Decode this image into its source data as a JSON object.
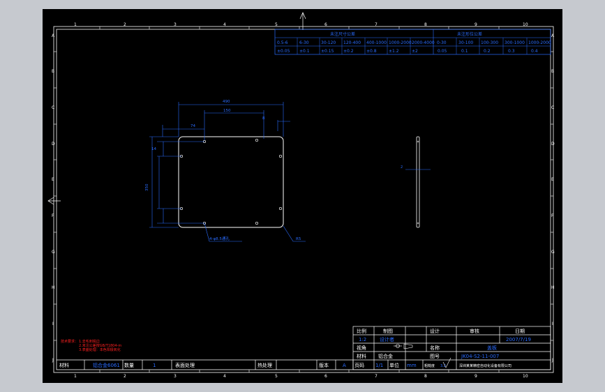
{
  "drawing": {
    "border_columns": [
      "1",
      "2",
      "3",
      "4",
      "5",
      "6",
      "7",
      "8",
      "9",
      "10"
    ],
    "border_rows": [
      "A",
      "B",
      "C",
      "D",
      "E",
      "F",
      "G",
      "H",
      "I",
      "J"
    ],
    "tolerance_table": {
      "title_left": "未注尺寸公差",
      "title_right": "未注形位公差",
      "header_left": [
        "0.5-6",
        "6-30",
        "30-120",
        "120-400",
        "400-1000",
        "1000-2000",
        "2000-4000"
      ],
      "header_right": [
        "0-30",
        "30-100",
        "100-300",
        "300-1000",
        "1000-2000"
      ],
      "values_left": [
        "±0.05",
        "±0.1",
        "±0.15",
        "±0.2",
        "±0.8",
        "±1.2",
        "±2"
      ],
      "values_right": [
        "0.05",
        "0.1",
        "0.2",
        "0.3",
        "0.4"
      ]
    },
    "dims": {
      "overall_width": "490",
      "inner_width": "150",
      "left_offset": "74",
      "right_offset": "8",
      "height_overall": "350",
      "side_small": "14",
      "hole_note": "4-φ8.5通孔",
      "corner_note": "R5",
      "section_note": "2"
    },
    "notes": {
      "title": "技术要求：",
      "lines": [
        "1.去毛刺锐边",
        "2.未注公差按GB/T1804-m",
        "3.表面处理：本色阳极氧化"
      ]
    },
    "title_block": {
      "scale_label": "比例",
      "scale_value": "1:2",
      "draw_label": "制图",
      "drawer": "设计者",
      "design_label": "设计",
      "check_label": "审核",
      "date_label": "日期",
      "date_value": "2007/7/19",
      "mark_label": "视角",
      "name_label": "名称",
      "name_value": "盖板",
      "material_label": "材料",
      "material_value": "铝合金6061",
      "qty_label": "数量",
      "qty_value": "1",
      "surface_label": "表面处理",
      "heat_label": "热处理",
      "version_label": "版本",
      "version_value": "A",
      "part_no_label": "图号",
      "part_no_value": "JK04-S2-11-007",
      "sheet_label": "页码",
      "sheet_value": "1/1",
      "unit_label": "单位",
      "unit_value": "mm",
      "roughness_label": "粗糙度",
      "roughness_value": "3.2",
      "company": "深圳某某精密自动化设备有限公司",
      "material_short": "铝合金"
    }
  }
}
